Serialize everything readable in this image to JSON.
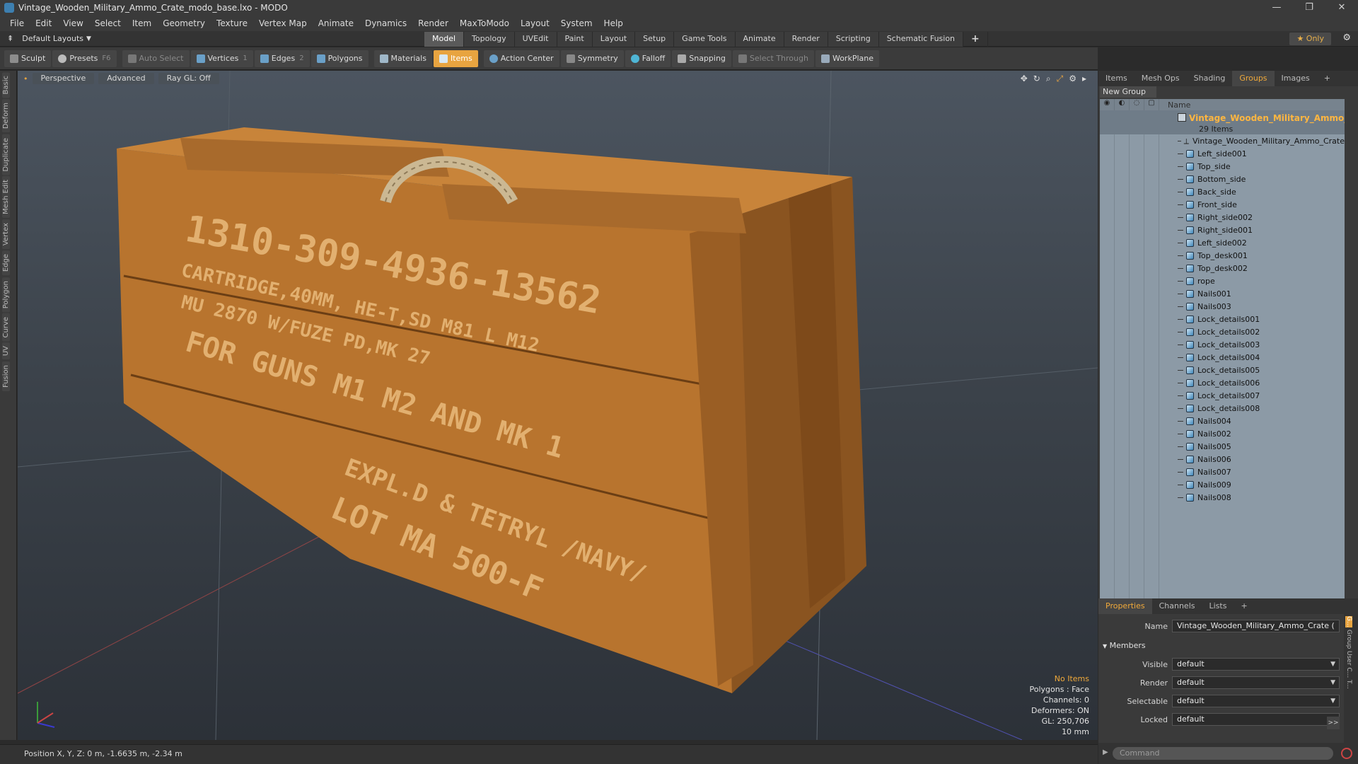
{
  "window": {
    "title": "Vintage_Wooden_Military_Ammo_Crate_modo_base.lxo - MODO",
    "minimize": "—",
    "maximize": "❐",
    "close": "✕"
  },
  "menu": [
    "File",
    "Edit",
    "View",
    "Select",
    "Item",
    "Geometry",
    "Texture",
    "Vertex Map",
    "Animate",
    "Dynamics",
    "Render",
    "MaxToModo",
    "Layout",
    "System",
    "Help"
  ],
  "layoutbar": {
    "layout_label": "Default Layouts",
    "tabs": [
      "Model",
      "Topology",
      "UVEdit",
      "Paint",
      "Layout",
      "Setup",
      "Game Tools",
      "Animate",
      "Render",
      "Scripting",
      "Schematic Fusion"
    ],
    "active_tab": "Model",
    "plus": "+",
    "only_label": "★ Only"
  },
  "toolbar": {
    "sculpt": "Sculpt",
    "presets": "Presets",
    "presets_key": "F6",
    "auto_select": "Auto Select",
    "vertices": "Vertices",
    "vertices_count": "1",
    "edges": "Edges",
    "edges_count": "2",
    "polygons": "Polygons",
    "materials": "Materials",
    "items": "Items",
    "action_center": "Action Center",
    "symmetry": "Symmetry",
    "falloff": "Falloff",
    "snapping": "Snapping",
    "select_through": "Select Through",
    "workplane": "WorkPlane"
  },
  "left_strip": [
    "Basic",
    "Deform",
    "Duplicate",
    "Mesh Edit",
    "Vertex",
    "Edge",
    "Polygon",
    "Curve",
    "UV",
    "Fusion"
  ],
  "viewport": {
    "view_mode": "Perspective",
    "shading": "Advanced",
    "raygl": "Ray GL: Off",
    "crate_lines": [
      "1310-309-4936-13562",
      "CARTRIDGE,40MM, HE-T,SD M81 L M12",
      "MU 2870 W/FUZE PD,MK 27",
      "FOR GUNS M1 M2 AND MK 1",
      "EXPL.D & TETRYL /NAVY/",
      "LOT MA 500-F"
    ],
    "info": {
      "selection": "No Items",
      "polygons": "Polygons : Face",
      "channels": "Channels: 0",
      "deformers": "Deformers: ON",
      "gl": "GL: 250,706",
      "scale": "10 mm"
    }
  },
  "statusbar": {
    "position": "Position X, Y, Z:  0 m, -1.6635 m, -2.34 m"
  },
  "right_panel": {
    "tabs": [
      "Items",
      "Mesh Ops",
      "Shading",
      "Groups",
      "Images",
      "+"
    ],
    "active_tab": "Groups",
    "new_group": "New Group",
    "name_header": "Name",
    "group_name": "Vintage_Wooden_Military_Ammo_C...",
    "group_count": "29 Items",
    "items": [
      "Vintage_Wooden_Military_Ammo_Crate",
      "Left_side001",
      "Top_side",
      "Bottom_side",
      "Back_side",
      "Front_side",
      "Right_side002",
      "Right_side001",
      "Left_side002",
      "Top_desk001",
      "Top_desk002",
      "rope",
      "Nails001",
      "Nails003",
      "Lock_details001",
      "Lock_details002",
      "Lock_details003",
      "Lock_details004",
      "Lock_details005",
      "Lock_details006",
      "Lock_details007",
      "Lock_details008",
      "Nails004",
      "Nails002",
      "Nails005",
      "Nails006",
      "Nails007",
      "Nails009",
      "Nails008"
    ]
  },
  "properties": {
    "tabs": [
      "Properties",
      "Channels",
      "Lists",
      "+"
    ],
    "active_tab": "Properties",
    "name_label": "Name",
    "name_value": "Vintage_Wooden_Military_Ammo_Crate (",
    "members": "Members",
    "visible_label": "Visible",
    "visible_value": "default",
    "render_label": "Render",
    "render_value": "default",
    "selectable_label": "Selectable",
    "selectable_value": "default",
    "locked_label": "Locked",
    "locked_value": "default",
    "side_tabs": [
      "G...",
      "Group",
      "User C...",
      "T..."
    ],
    "expand": ">>"
  },
  "command": {
    "placeholder": "Command"
  },
  "colors": {
    "accent": "#e8a440",
    "group_name": "#ffb640",
    "crate_wood": "#b8742e"
  }
}
